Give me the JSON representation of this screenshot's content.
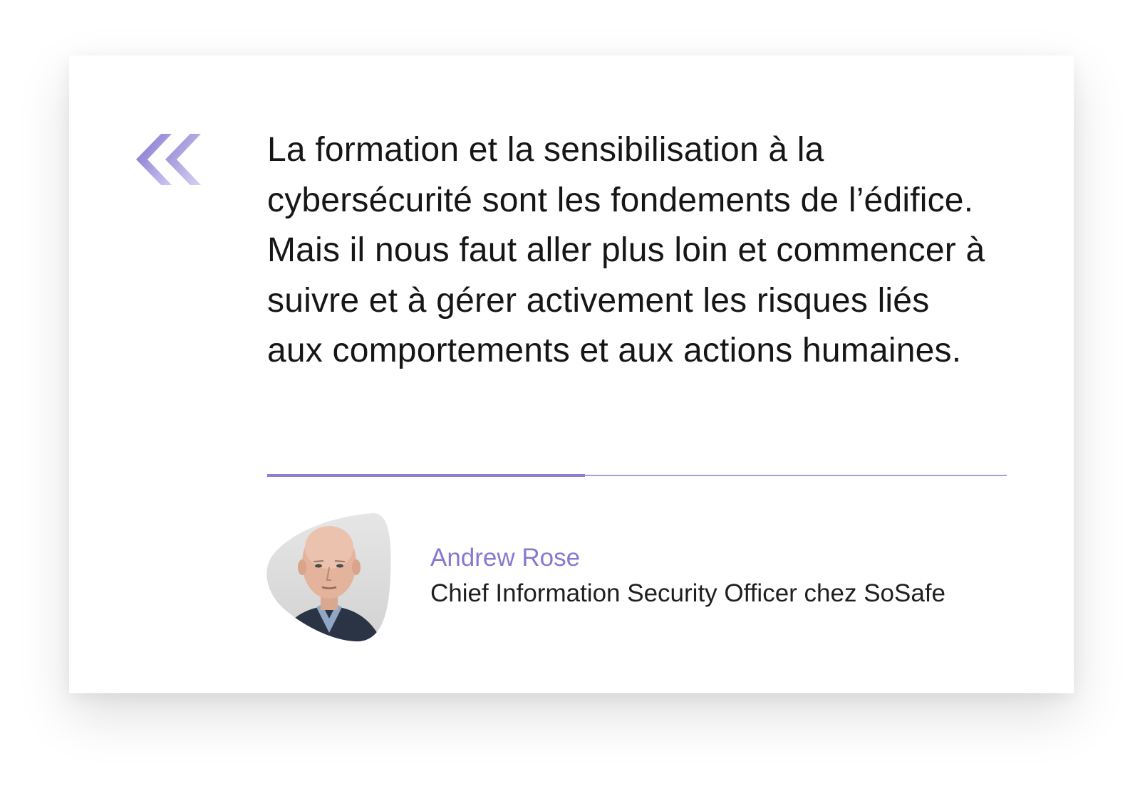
{
  "quote": {
    "text": "La formation et la sensibilisation à la cybersécurité sont les fondements de l’édifice. Mais il nous faut aller plus loin et commencer à suivre et à gérer activement les risques liés aux comportements et aux actions humaines."
  },
  "author": {
    "name": "Andrew Rose",
    "title": "Chief Information Security Officer chez SoSafe"
  },
  "divider": {
    "progress_fraction": 0.43
  },
  "icons": {
    "quote_mark": "double-chevron-left-quote-icon",
    "avatar": "author-portrait"
  },
  "colors": {
    "accent": "#8679cf",
    "accent_light": "#c7c2ee",
    "divider": "#a49fd8",
    "text": "#161616",
    "background": "#ffffff"
  }
}
